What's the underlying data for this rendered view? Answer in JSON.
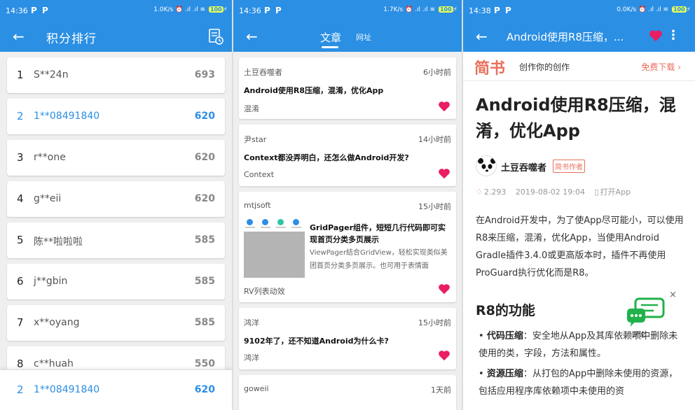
{
  "colors": {
    "primary": "#2b8fe4",
    "heart": "#e91e63",
    "jianshu": "#ea6f5a"
  },
  "screen1": {
    "status": {
      "time": "14:36",
      "speed": "1.0K/s",
      "battery": "100"
    },
    "title": "积分排行",
    "ranks": [
      {
        "n": "1",
        "name": "S**24n",
        "score": "693"
      },
      {
        "n": "2",
        "name": "1**08491840",
        "score": "620"
      },
      {
        "n": "3",
        "name": "r**one",
        "score": "620"
      },
      {
        "n": "4",
        "name": "g**eii",
        "score": "620"
      },
      {
        "n": "5",
        "name": "陈**啦啦啦",
        "score": "585"
      },
      {
        "n": "6",
        "name": "j**gbin",
        "score": "585"
      },
      {
        "n": "7",
        "name": "x**oyang",
        "score": "585"
      },
      {
        "n": "8",
        "name": "c**huah",
        "score": "550"
      }
    ],
    "me": {
      "n": "2",
      "name": "1**08491840",
      "score": "620"
    }
  },
  "screen2": {
    "status": {
      "time": "14:36",
      "speed": "1.7K/s",
      "battery": "100"
    },
    "tabs": [
      "文章",
      "网址"
    ],
    "cards": [
      {
        "author": "土豆吞噬者",
        "time": "6小时前",
        "title": "Android使用R8压缩，混淆，优化App",
        "tag": "混淆"
      },
      {
        "author": "尹star",
        "time": "14小时前",
        "title": "Context都没弄明白，还怎么做Android开发?",
        "tag": "Context"
      },
      {
        "author": "mtjsoft",
        "time": "15小时前",
        "title": "GridPager组件，短短几行代码即可实现首页分类多页展示",
        "desc": "ViewPager结合GridView，轻松实现类似美团首页分类多页展示。也可用于表情面",
        "tag": "RV列表动效"
      },
      {
        "author": "鸿洋",
        "time": "15小时前",
        "title": "9102年了，还不知道Android为什么卡?",
        "tag": "鸿洋"
      },
      {
        "author": "goweii",
        "time": "1天前"
      }
    ]
  },
  "screen3": {
    "status": {
      "time": "14:38",
      "speed": "0.0K/s",
      "battery": "100"
    },
    "title": "Android使用R8压缩，...",
    "banner": {
      "logo": "简书",
      "slogan": "创作你的创作",
      "download": "免费下载"
    },
    "article_title": "Android使用R8压缩，混淆，优化App",
    "author": "土豆吞噬者",
    "author_badge": "简书作者",
    "meta": {
      "diamonds": "2.293",
      "date": "2019-08-02 19:04",
      "open": "打开App"
    },
    "para": "在Android开发中，为了使App尽可能小，可以使用R8来压缩，混淆，优化App，当使用Android Gradle插件3.4.0或更高版本时，插件不再使用ProGuard执行优化而是R8。",
    "h2": "R8的功能",
    "bullets": [
      {
        "label": "代码压缩",
        "text": "：安全地从App及其库依赖项中删除未使用的类，字段，方法和属性。"
      },
      {
        "label": "资源压缩",
        "text": "：从打包的App中删除未使用的资源，包括应用程序库依赖项中未使用的资"
      }
    ],
    "chat_label": "评论"
  }
}
